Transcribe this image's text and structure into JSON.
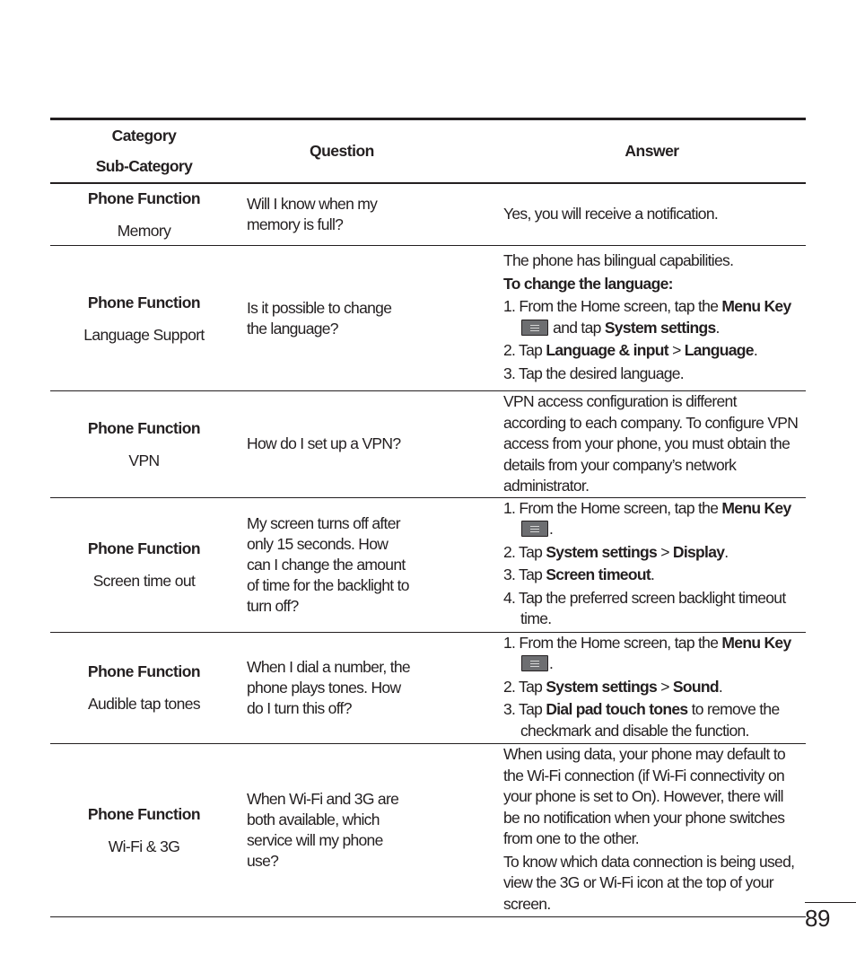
{
  "header": {
    "category": "Category",
    "sub_category": "Sub-Category",
    "question": "Question",
    "answer": "Answer"
  },
  "rows": [
    {
      "category": "Phone Function",
      "sub_category": "Memory",
      "question": "Will I know when my memory is full?",
      "answer_intro": "Yes, you will receive a notification."
    },
    {
      "category": "Phone Function",
      "sub_category": "Language Support",
      "question": "Is it possible to change the language?",
      "answer_intro": "The phone has bilingual capabilities.",
      "answer_heading": "To change the language:",
      "steps": [
        {
          "n": "1. ",
          "pre": "From the Home screen, tap the ",
          "b1": "Menu Key",
          "mid": " and tap ",
          "b2": "System settings",
          "post": "."
        },
        {
          "n": "2. ",
          "pre": "Tap ",
          "b1": "Language & input",
          "mid": " > ",
          "b2": "Language",
          "post": "."
        },
        {
          "n": "3. ",
          "pre": "Tap the desired language."
        }
      ]
    },
    {
      "category": "Phone Function",
      "sub_category": "VPN",
      "question": "How do I set up a VPN?",
      "answer_intro": "VPN access configuration is different according to each company. To configure VPN access from your phone, you must obtain the details from your company’s network administrator."
    },
    {
      "category": "Phone Function",
      "sub_category": "Screen time out",
      "question": "My screen turns off after only 15 seconds. How can I change the amount of time for the backlight to turn off?",
      "steps": [
        {
          "n": "1. ",
          "pre": "From the Home screen, tap the ",
          "b1": "Menu Key",
          "post": "."
        },
        {
          "n": "2. ",
          "pre": "Tap ",
          "b1": "System settings",
          "mid": " > ",
          "b2": "Display",
          "post": "."
        },
        {
          "n": "3. ",
          "pre": "Tap ",
          "b1": "Screen timeout",
          "post": "."
        },
        {
          "n": "4. ",
          "pre": "Tap the preferred screen backlight timeout time."
        }
      ]
    },
    {
      "category": "Phone Function",
      "sub_category": "Audible tap tones",
      "question": "When I dial a number, the phone plays tones. How do I turn this off?",
      "steps": [
        {
          "n": "1. ",
          "pre": "From the Home screen, tap the ",
          "b1": "Menu Key",
          "post": "."
        },
        {
          "n": "2. ",
          "pre": "Tap ",
          "b1": "System settings",
          "mid": " > ",
          "b2": "Sound",
          "post": "."
        },
        {
          "n": "3. ",
          "pre": "Tap ",
          "b1": "Dial pad touch tones",
          "post": " to remove the checkmark and disable the function."
        }
      ]
    },
    {
      "category": "Phone Function",
      "sub_category": "Wi-Fi & 3G",
      "question": "When Wi-Fi and 3G are both available, which service will my phone use?",
      "answer_intro": "When using data, your phone may default to the Wi-Fi connection (if Wi-Fi connectivity on your phone is set to On). However, there will be no notification when your phone switches from one to the other.",
      "answer_extra": "To know which data connection is being used, view the 3G or Wi-Fi icon at the top of your screen."
    }
  ],
  "icons": {
    "menu_key": "menu-key-icon"
  },
  "page_number": "89"
}
